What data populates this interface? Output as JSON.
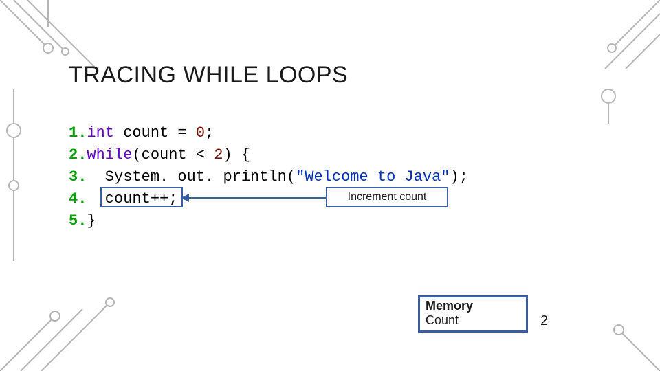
{
  "title": "TRACING WHILE LOOPS",
  "code": {
    "l1_num": "1.",
    "l1_a": "int",
    "l1_b": " count = ",
    "l1_c": "0",
    "l1_d": ";",
    "l2_num": "2.",
    "l2_a": "while",
    "l2_b": "(count < ",
    "l2_c": "2",
    "l2_d": ") {",
    "l3_num": "3.",
    "l3_a": "  System. out. println(",
    "l3_b": "\"Welcome to Java\"",
    "l3_c": ");",
    "l4_num": "4.",
    "l4_a": "  count++;",
    "l5_num": "5.",
    "l5_a": "}"
  },
  "annotation": "Increment count",
  "memory": {
    "header": "Memory",
    "var": "Count",
    "value": "2"
  }
}
